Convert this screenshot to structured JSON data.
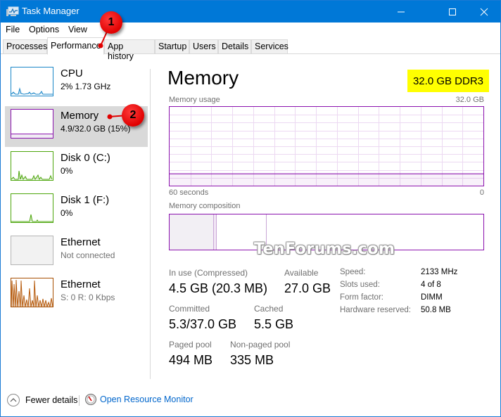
{
  "window": {
    "title": "Task Manager",
    "minimize_label": "Minimize",
    "maximize_label": "Maximize",
    "close_label": "Close"
  },
  "menu": [
    "File",
    "Options",
    "View"
  ],
  "tabs": [
    {
      "label": "Processes",
      "active": false
    },
    {
      "label": "Performance",
      "active": true
    },
    {
      "label": "App history",
      "active": false
    },
    {
      "label": "Startup",
      "active": false
    },
    {
      "label": "Users",
      "active": false
    },
    {
      "label": "Details",
      "active": false
    },
    {
      "label": "Services",
      "active": false
    }
  ],
  "sidebar": {
    "items": [
      {
        "title": "CPU",
        "subtitle": "2% 1.73 GHz",
        "color": "#1a86c8",
        "selected": false
      },
      {
        "title": "Memory",
        "subtitle": "4.9/32.0 GB (15%)",
        "color": "#8b12ae",
        "selected": true
      },
      {
        "title": "Disk 0 (C:)",
        "subtitle": "0%",
        "color": "#4da60c",
        "selected": false
      },
      {
        "title": "Disk 1 (F:)",
        "subtitle": "0%",
        "color": "#4da60c",
        "selected": false
      },
      {
        "title": "Ethernet",
        "subtitle": "Not connected",
        "color": "#a0a0a0",
        "selected": false
      },
      {
        "title": "Ethernet",
        "subtitle": "S: 0 R: 0 Kbps",
        "color": "#a74f01",
        "selected": false
      }
    ]
  },
  "main": {
    "title": "Memory",
    "badge": "32.0 GB DDR3",
    "usage_label": "Memory usage",
    "usage_max": "32.0 GB",
    "time_left": "60 seconds",
    "time_right": "0",
    "usage_fraction": 0.15,
    "composition_label": "Memory composition",
    "composition": {
      "in_use_fraction": 0.14,
      "modified_fraction": 0.01,
      "standby_fraction": 0.16
    },
    "stats": [
      {
        "label": "In use (Compressed)",
        "value": "4.5 GB (20.3 MB)"
      },
      {
        "label": "Available",
        "value": "27.0 GB"
      },
      {
        "label": "Committed",
        "value": "5.3/37.0 GB"
      },
      {
        "label": "Cached",
        "value": "5.5 GB"
      },
      {
        "label": "Paged pool",
        "value": "494 MB"
      },
      {
        "label": "Non-paged pool",
        "value": "335 MB"
      }
    ],
    "details": [
      {
        "label": "Speed:",
        "value": "2133 MHz"
      },
      {
        "label": "Slots used:",
        "value": "4 of 8"
      },
      {
        "label": "Form factor:",
        "value": "DIMM"
      },
      {
        "label": "Hardware reserved:",
        "value": "50.8 MB"
      }
    ]
  },
  "footer": {
    "fewer_details": "Fewer details",
    "resource_monitor": "Open Resource Monitor"
  },
  "annotations": {
    "callout_1": "1",
    "callout_2": "2",
    "watermark": "TenForums.com"
  },
  "colors": {
    "titlebar": "#0078d7",
    "memory_accent": "#8b12ae",
    "link": "#0066cc",
    "highlight": "#ffff00"
  }
}
